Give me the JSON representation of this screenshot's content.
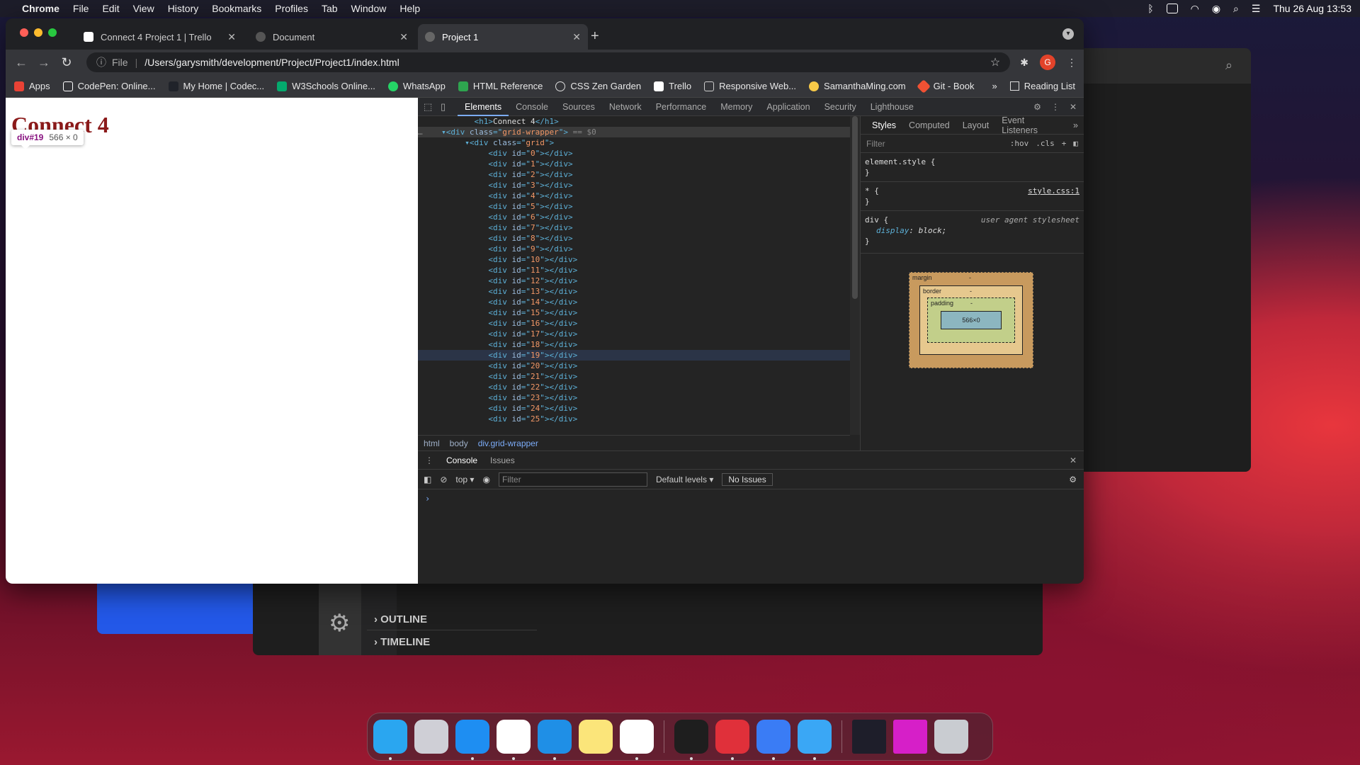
{
  "menubar": {
    "app": "Chrome",
    "items": [
      "File",
      "Edit",
      "View",
      "History",
      "Bookmarks",
      "Profiles",
      "Tab",
      "Window",
      "Help"
    ],
    "clock": "Thu 26 Aug  13:53"
  },
  "background": {
    "outline_label": "OUTLINE",
    "timeline_label": "TIMELINE"
  },
  "browser": {
    "tabs": [
      {
        "title": "Connect 4 Project 1 | Trello"
      },
      {
        "title": "Document"
      },
      {
        "title": "Project 1"
      }
    ],
    "url_prefix": "File",
    "url": "/Users/garysmith/development/Project/Project1/index.html",
    "avatar_letter": "G",
    "bookmarks": [
      {
        "label": "Apps",
        "color": "#e94235"
      },
      {
        "label": "CodePen: Online...",
        "color": "#ffffff"
      },
      {
        "label": "My Home | Codec...",
        "color": "#20232a"
      },
      {
        "label": "W3Schools Online...",
        "color": "#04aa6d"
      },
      {
        "label": "WhatsApp",
        "color": "#25d366"
      },
      {
        "label": "HTML Reference",
        "color": "#35363a"
      },
      {
        "label": "CSS Zen Garden",
        "color": "#35363a"
      },
      {
        "label": "Trello",
        "color": "#0079bf"
      },
      {
        "label": "Responsive Web...",
        "color": "#35363a"
      },
      {
        "label": "SamanthaMing.com",
        "color": "#f7c948"
      },
      {
        "label": "Git - Book",
        "color": "#f05133"
      }
    ],
    "more_label": "»",
    "reading_list": "Reading List"
  },
  "page": {
    "heading": "Connect 4",
    "tooltip_tag": "div#19",
    "tooltip_dims": "566 × 0"
  },
  "devtools": {
    "tabs": [
      "Elements",
      "Console",
      "Sources",
      "Network",
      "Performance",
      "Memory",
      "Application",
      "Security",
      "Lighthouse"
    ],
    "active_tab": "Elements",
    "h1_line": "Connect 4",
    "wrapper_class": "grid-wrapper",
    "grid_class": "grid",
    "selected_marker": "== $0",
    "grid_ids": [
      "0",
      "1",
      "2",
      "3",
      "4",
      "5",
      "6",
      "7",
      "8",
      "9",
      "10",
      "11",
      "12",
      "13",
      "14",
      "15",
      "16",
      "17",
      "18",
      "19",
      "20",
      "21",
      "22",
      "23",
      "24",
      "25"
    ],
    "hovered_id": "19",
    "breadcrumbs": [
      "html",
      "body",
      "div.grid-wrapper"
    ],
    "styles_tabs": [
      "Styles",
      "Computed",
      "Layout",
      "Event Listeners"
    ],
    "styles_more": "»",
    "filter_placeholder": "Filter",
    "hov": ":hov",
    "cls": ".cls",
    "rules": {
      "element_style": "element.style {",
      "universal": "* {",
      "universal_src": "style.css:1",
      "div_sel": "div {",
      "div_src": "user agent stylesheet",
      "div_prop": "display",
      "div_val": "block;"
    },
    "box": {
      "margin": "margin",
      "border": "border",
      "padding": "padding",
      "content": "566×0",
      "dash": "-"
    },
    "drawer": {
      "tabs": [
        "Console",
        "Issues"
      ],
      "context": "top",
      "filter_placeholder": "Filter",
      "levels": "Default levels",
      "issues": "No Issues",
      "prompt": "›"
    }
  },
  "dock": {
    "apps": [
      {
        "name": "finder",
        "color": "#2aa6f0",
        "running": true
      },
      {
        "name": "launchpad",
        "color": "#cfcfd6",
        "running": false
      },
      {
        "name": "safari",
        "color": "#1e8ef2",
        "running": true
      },
      {
        "name": "chrome",
        "color": "#ffffff",
        "running": true
      },
      {
        "name": "vscode",
        "color": "#1f8fe6",
        "running": true
      },
      {
        "name": "notes",
        "color": "#fbe57a",
        "running": false
      },
      {
        "name": "slack",
        "color": "#ffffff",
        "running": true
      },
      {
        "name": "terminal",
        "color": "#1e1e1e",
        "running": true
      },
      {
        "name": "bear",
        "color": "#e0303a",
        "running": true
      },
      {
        "name": "sketch",
        "color": "#3a7cf5",
        "running": true
      },
      {
        "name": "mail",
        "color": "#3aa7f5",
        "running": true
      }
    ],
    "minimized": [
      {
        "name": "window-thumb-1",
        "color": "#1e1e2a"
      },
      {
        "name": "window-thumb-2",
        "color": "#d61fc8"
      }
    ],
    "trash_color": "#c9ccd1"
  }
}
